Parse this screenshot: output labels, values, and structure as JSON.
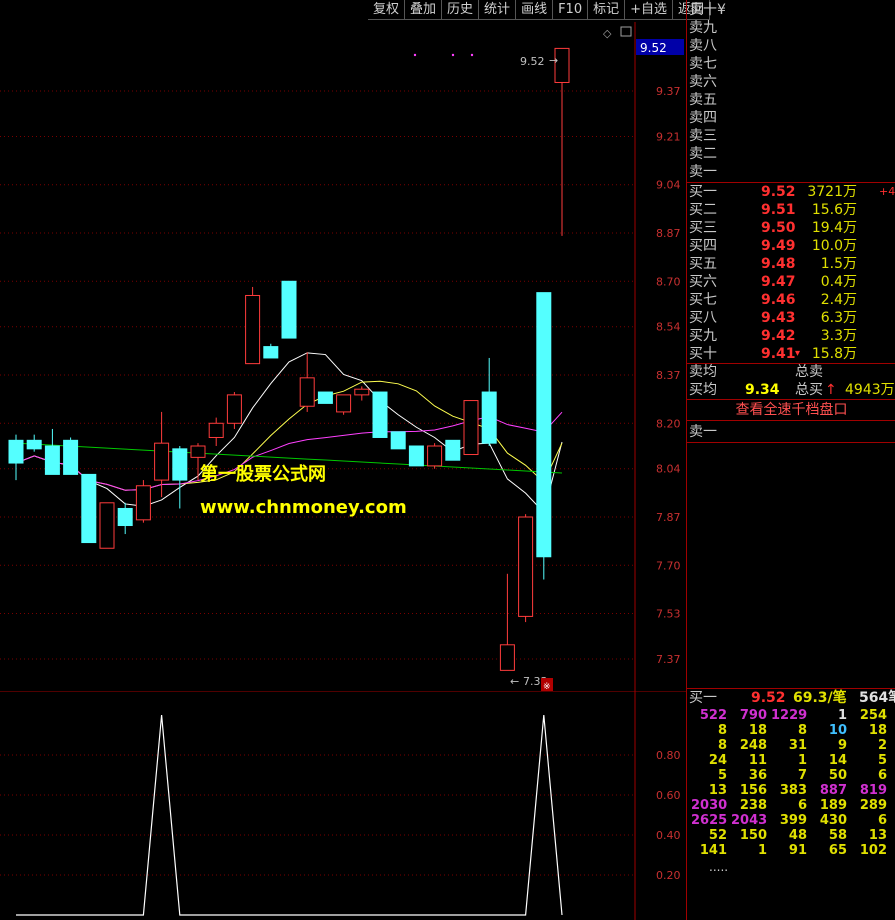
{
  "toolbar": {
    "buttons": [
      "复权",
      "叠加",
      "历史",
      "统计",
      "画线",
      "F10",
      "标记",
      "+自选",
      "返回"
    ]
  },
  "chart_header": {
    "current_price_tag": "9.52"
  },
  "price_axis": {
    "labels": [
      "9.37",
      "9.21",
      "9.04",
      "8.87",
      "8.70",
      "8.54",
      "8.37",
      "8.20",
      "8.04",
      "7.87",
      "7.70",
      "7.53",
      "7.37"
    ]
  },
  "indicator_axis": {
    "labels": [
      "0.80",
      "0.60",
      "0.40",
      "0.20"
    ]
  },
  "annotations": {
    "high_label": "9.52",
    "low_label": "7.33"
  },
  "watermark": {
    "line1": "第一股票公式网",
    "line2": "www.chnmoney.com"
  },
  "order_book": {
    "asks": [
      {
        "label": "卖十",
        "extra": "¥"
      },
      {
        "label": "卖九"
      },
      {
        "label": "卖八"
      },
      {
        "label": "卖七"
      },
      {
        "label": "卖六"
      },
      {
        "label": "卖五"
      },
      {
        "label": "卖四"
      },
      {
        "label": "卖三"
      },
      {
        "label": "卖二"
      },
      {
        "label": "卖一"
      }
    ],
    "bids": [
      {
        "label": "买一",
        "price": "9.52",
        "volume": "3721万",
        "extra": "+4"
      },
      {
        "label": "买二",
        "price": "9.51",
        "volume": "15.6万"
      },
      {
        "label": "买三",
        "price": "9.50",
        "volume": "19.4万"
      },
      {
        "label": "买四",
        "price": "9.49",
        "volume": "10.0万"
      },
      {
        "label": "买五",
        "price": "9.48",
        "volume": "1.5万"
      },
      {
        "label": "买六",
        "price": "9.47",
        "volume": "0.4万"
      },
      {
        "label": "买七",
        "price": "9.46",
        "volume": "2.4万"
      },
      {
        "label": "买八",
        "price": "9.43",
        "volume": "6.3万"
      },
      {
        "label": "买九",
        "price": "9.42",
        "volume": "3.3万"
      },
      {
        "label": "买十",
        "price": "9.41",
        "volume": "15.8万",
        "arrow": "▾"
      }
    ],
    "summary": {
      "ask_avg_label": "卖均",
      "total_ask_label": "总卖",
      "bid_avg_label": "买均",
      "bid_avg_value": "9.34",
      "total_bid_label": "总买",
      "total_bid_arrow": "↑",
      "total_bid_value": "4943万"
    },
    "view_all_label": "查看全速千档盘口",
    "queue_label": "卖一"
  },
  "tick_queue": {
    "header": {
      "label": "买一",
      "price": "9.52",
      "avg": "69.3/笔",
      "count": "564笔"
    },
    "rows": [
      [
        "522",
        "790",
        "1229",
        "1",
        "254"
      ],
      [
        "8",
        "18",
        "8",
        "10",
        "18"
      ],
      [
        "8",
        "248",
        "31",
        "9",
        "2"
      ],
      [
        "24",
        "11",
        "1",
        "14",
        "5"
      ],
      [
        "5",
        "36",
        "7",
        "50",
        "6"
      ],
      [
        "13",
        "156",
        "383",
        "887",
        "819"
      ],
      [
        "2030",
        "238",
        "6",
        "189",
        "289"
      ],
      [
        "2625",
        "2043",
        "399",
        "430",
        "6"
      ],
      [
        "52",
        "150",
        "48",
        "58",
        "13"
      ],
      [
        "141",
        "1",
        "91",
        "65",
        "102"
      ]
    ],
    "more": "....."
  },
  "colors": {
    "up": "#ff3c3c",
    "down": "#54ffff",
    "ma5": "#ffffff",
    "ma10": "#ffff50",
    "ma20": "#ff40ff",
    "ma60": "#00c800"
  },
  "chart_data": {
    "type": "candlestick",
    "y_range": [
      7.2,
      9.6
    ],
    "candles": [
      {
        "o": 8.14,
        "h": 8.16,
        "l": 8.0,
        "c": 8.06
      },
      {
        "o": 8.14,
        "h": 8.16,
        "l": 8.1,
        "c": 8.11
      },
      {
        "o": 8.12,
        "h": 8.18,
        "l": 8.02,
        "c": 8.02
      },
      {
        "o": 8.14,
        "h": 8.15,
        "l": 8.02,
        "c": 8.02
      },
      {
        "o": 8.02,
        "h": 8.02,
        "l": 7.78,
        "c": 7.78
      },
      {
        "o": 7.76,
        "h": 7.92,
        "l": 7.76,
        "c": 7.92
      },
      {
        "o": 7.9,
        "h": 7.92,
        "l": 7.81,
        "c": 7.84
      },
      {
        "o": 7.86,
        "h": 8.0,
        "l": 7.85,
        "c": 7.98
      },
      {
        "o": 8.0,
        "h": 8.24,
        "l": 7.94,
        "c": 8.13
      },
      {
        "o": 8.11,
        "h": 8.12,
        "l": 7.9,
        "c": 8.0
      },
      {
        "o": 8.08,
        "h": 8.13,
        "l": 8.0,
        "c": 8.12
      },
      {
        "o": 8.15,
        "h": 8.22,
        "l": 8.12,
        "c": 8.2
      },
      {
        "o": 8.2,
        "h": 8.31,
        "l": 8.18,
        "c": 8.3
      },
      {
        "o": 8.41,
        "h": 8.68,
        "l": 8.41,
        "c": 8.65
      },
      {
        "o": 8.47,
        "h": 8.48,
        "l": 8.43,
        "c": 8.43
      },
      {
        "o": 8.7,
        "h": 8.7,
        "l": 8.5,
        "c": 8.5
      },
      {
        "o": 8.26,
        "h": 8.45,
        "l": 8.24,
        "c": 8.36
      },
      {
        "o": 8.31,
        "h": 8.31,
        "l": 8.27,
        "c": 8.27
      },
      {
        "o": 8.24,
        "h": 8.3,
        "l": 8.23,
        "c": 8.3
      },
      {
        "o": 8.3,
        "h": 8.33,
        "l": 8.28,
        "c": 8.32
      },
      {
        "o": 8.31,
        "h": 8.31,
        "l": 8.15,
        "c": 8.15
      },
      {
        "o": 8.17,
        "h": 8.17,
        "l": 8.11,
        "c": 8.11
      },
      {
        "o": 8.12,
        "h": 8.12,
        "l": 8.05,
        "c": 8.05
      },
      {
        "o": 8.05,
        "h": 8.13,
        "l": 8.04,
        "c": 8.12
      },
      {
        "o": 8.14,
        "h": 8.14,
        "l": 8.07,
        "c": 8.07
      },
      {
        "o": 8.09,
        "h": 8.28,
        "l": 8.09,
        "c": 8.28
      },
      {
        "o": 8.31,
        "h": 8.43,
        "l": 8.12,
        "c": 8.13
      },
      {
        "o": 7.33,
        "h": 7.67,
        "l": 7.33,
        "c": 7.42
      },
      {
        "o": 7.52,
        "h": 7.88,
        "l": 7.5,
        "c": 7.87
      },
      {
        "o": 8.66,
        "h": 8.66,
        "l": 7.65,
        "c": 7.73
      },
      {
        "o": 9.4,
        "h": 9.52,
        "l": 8.86,
        "c": 9.52
      }
    ],
    "indicator": {
      "values": [
        0,
        0,
        0,
        0,
        0,
        0,
        0,
        0,
        1,
        0,
        0,
        0,
        0,
        0,
        0,
        0,
        0,
        0,
        0,
        0,
        0,
        0,
        0,
        0,
        0,
        0,
        0,
        0,
        0,
        1,
        0
      ],
      "y_range": [
        0,
        1.1
      ]
    }
  }
}
